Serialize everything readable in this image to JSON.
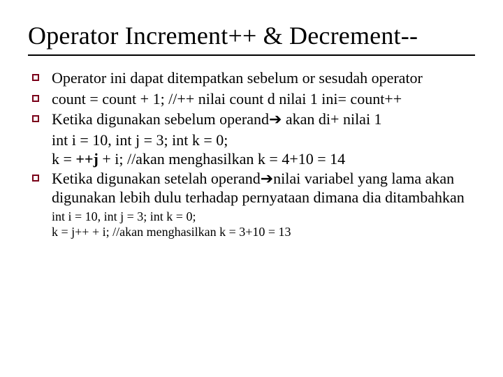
{
  "title": "Operator Increment++ & Decrement--",
  "bullets": {
    "b1": "Operator ini dapat ditempatkan sebelum or sesudah operator",
    "b2": "count = count + 1; //++ nilai count d nilai 1 ini= count++",
    "b3_pre": "Ketika digunakan sebelum operand",
    "arrow": "➔",
    "b3_post": " akan di+ nilai 1",
    "b3_cont1": "int i = 10, int j = 3; int k = 0;",
    "b3_cont2_pre": "k = ",
    "b3_cont2_bold": "++j",
    "b3_cont2_post": " + i; //akan menghasilkan k = 4+10 = 14",
    "b4_pre": "Ketika digunakan setelah operand",
    "b4_post": "nilai variabel yang lama akan digunakan lebih dulu terhadap pernyataan dimana dia ditambahkan"
  },
  "small": {
    "s1": "int i = 10, int j = 3; int k = 0;",
    "s2": "k = j++ + i; //akan menghasilkan k = 3+10 = 13"
  }
}
